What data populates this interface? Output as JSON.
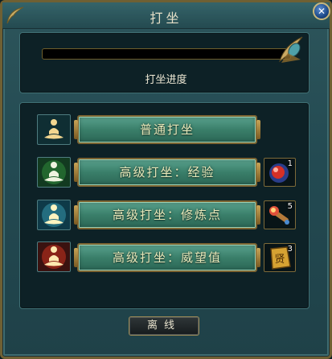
{
  "window": {
    "title": "打坐"
  },
  "progress": {
    "label": "打坐进度",
    "value": 0
  },
  "actions": [
    {
      "label": "普通打坐",
      "icon": "meditation-basic-icon",
      "item_count": null
    },
    {
      "label": "高级打坐：经验",
      "icon": "meditation-experience-icon",
      "item_count": "1",
      "item_icon": "red-orb-item-icon"
    },
    {
      "label": "高级打坐：修炼点",
      "icon": "meditation-cultivation-icon",
      "item_count": "5",
      "item_icon": "torch-item-icon"
    },
    {
      "label": "高级打坐：威望值",
      "icon": "meditation-prestige-icon",
      "item_count": "3",
      "item_icon": "prestige-token-item-icon",
      "item_glyph": "贤"
    }
  ],
  "footer": {
    "logout_label": "离线"
  },
  "colors": {
    "frame_gold": "#6f6033",
    "button_green": "#3a7f6a",
    "button_text": "#e8e9ba"
  }
}
